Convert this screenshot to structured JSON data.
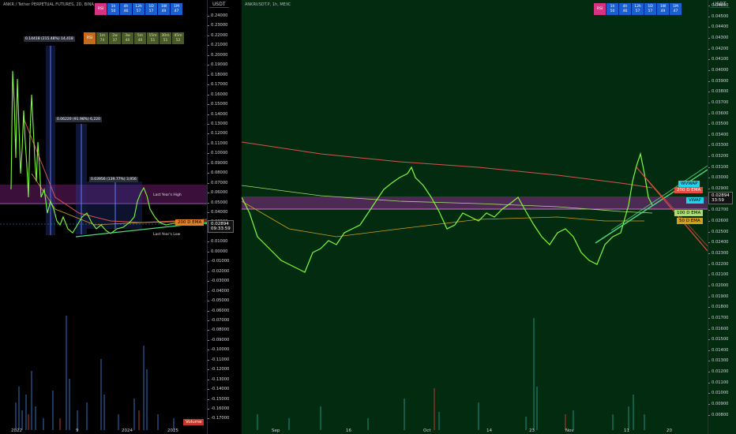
{
  "left_chart": {
    "title": "ANKR / Tether PERPETUAL FUTURES, 2D, BINA",
    "rsi_top": {
      "header": "RSI",
      "cells": [
        {
          "tf": "1h",
          "val": "50"
        },
        {
          "tf": "4h",
          "val": "46"
        },
        {
          "tf": "12h",
          "val": "57"
        },
        {
          "tf": "1D",
          "val": "57"
        },
        {
          "tf": "1W",
          "val": "49"
        },
        {
          "tf": "1M",
          "val": "47"
        }
      ]
    },
    "rsi_mid": {
      "header": "RSI",
      "cells": [
        {
          "tf": "1m",
          "val": "74"
        },
        {
          "tf": "2w",
          "val": "37"
        },
        {
          "tf": "3w",
          "val": "40"
        },
        {
          "tf": "5m",
          "val": "40"
        },
        {
          "tf": "15m",
          "val": "51"
        },
        {
          "tf": "30m",
          "val": "51"
        },
        {
          "tf": "45m",
          "val": "52"
        }
      ]
    },
    "measures": [
      "0.14418 (215.48%) 14,418",
      "0.06220 (91.98%) 6,220",
      "0.03956 (139.77%) 3,956"
    ],
    "annotations": {
      "last_year_high": "Last Year's High",
      "last_year_low": "Last Year's Low"
    },
    "price_tag": "0.02894",
    "countdown": "09:33:59",
    "ema_tag": "200 D EMA",
    "volume_tag": "Volume",
    "x_labels": [
      "2022",
      "9",
      "2024",
      "2025"
    ]
  },
  "left_axis": {
    "currency": "USDT",
    "ticks": [
      "0.24000",
      "0.23000",
      "0.22000",
      "0.21000",
      "0.20000",
      "0.19000",
      "0.18000",
      "0.17000",
      "0.16000",
      "0.15000",
      "0.14000",
      "0.13000",
      "0.12000",
      "0.11000",
      "0.10000",
      "0.09000",
      "0.08000",
      "0.07000",
      "0.06000",
      "0.05000",
      "0.04000",
      "0.03000",
      "0.02000",
      "0.01000",
      "0.00000",
      "-0.01000",
      "-0.02000",
      "-0.03000",
      "-0.04000",
      "-0.05000",
      "-0.06000",
      "-0.07000",
      "-0.08000",
      "-0.09000",
      "-0.10000",
      "-0.11000",
      "-0.12000",
      "-0.13000",
      "-0.14000",
      "-0.15000",
      "-0.16000",
      "-0.17000"
    ]
  },
  "right_chart": {
    "title": "ANKRUSDT.P, 1h, MEXC",
    "rsi_top": {
      "header": "RSI",
      "cells": [
        {
          "tf": "1h",
          "val": "50"
        },
        {
          "tf": "4h",
          "val": "46"
        },
        {
          "tf": "12h",
          "val": "57"
        },
        {
          "tf": "1D",
          "val": "57"
        },
        {
          "tf": "1W",
          "val": "49"
        },
        {
          "tf": "1M",
          "val": "47"
        }
      ]
    },
    "tags": {
      "wvwap": "WVWAP",
      "ema200": "200 D EMA",
      "vwap": "VWAP",
      "ema100": "100 D EMA",
      "ema50": "50 D EMA"
    },
    "price_tag": "0.02894",
    "countdown": "33:59",
    "x_labels": [
      "Sep",
      "16",
      "Oct",
      "14",
      "23",
      "Nov",
      "11",
      "20"
    ]
  },
  "right_axis": {
    "currency": "USDT",
    "ticks": [
      "0.04600",
      "0.04500",
      "0.04400",
      "0.04300",
      "0.04200",
      "0.04100",
      "0.04000",
      "0.03900",
      "0.03800",
      "0.03700",
      "0.03600",
      "0.03500",
      "0.03400",
      "0.03300",
      "0.03200",
      "0.03100",
      "0.03000",
      "0.02900",
      "0.02800",
      "0.02700",
      "0.02600",
      "0.02500",
      "0.02400",
      "0.02300",
      "0.02200",
      "0.02100",
      "0.02000",
      "0.01900",
      "0.01800",
      "0.01700",
      "0.01600",
      "0.01500",
      "0.01400",
      "0.01300",
      "0.01200",
      "0.01100",
      "0.01000",
      "0.00900",
      "0.00800"
    ]
  },
  "colors": {
    "price_line": "#7CFC3A",
    "ema200": "#d9534f",
    "ema100": "#8ee07a",
    "ema50": "#d4a017",
    "band": "#8a2a8a",
    "vwap": "#22d3ee",
    "rsi_pink": "#d63384",
    "rsi_blue": "#1a5fd1"
  }
}
